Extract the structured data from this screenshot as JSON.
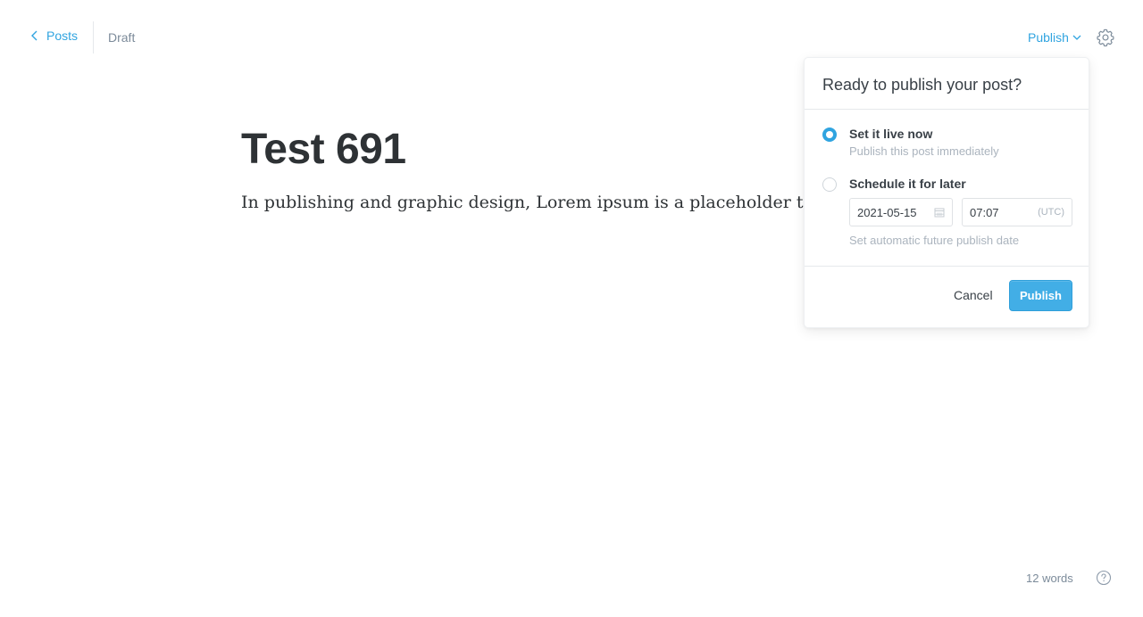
{
  "nav": {
    "back_label": "Posts",
    "status": "Draft",
    "publish_menu_label": "Publish"
  },
  "post": {
    "title": "Test 691",
    "body": "In publishing and graphic design, Lorem ipsum is a placeholder text 31"
  },
  "publish_popup": {
    "heading": "Ready to publish your post?",
    "options": [
      {
        "label": "Set it live now",
        "description": "Publish this post immediately",
        "selected": true
      },
      {
        "label": "Schedule it for later",
        "description": "Set automatic future publish date",
        "selected": false
      }
    ],
    "date_value": "2021-05-15",
    "time_value": "07:07",
    "timezone": "(UTC)",
    "cancel_label": "Cancel",
    "publish_label": "Publish"
  },
  "footer": {
    "word_count": "12 words"
  },
  "icons": {
    "back": "chevron-left-icon",
    "publish_menu": "chevron-down-icon",
    "settings": "gear-icon",
    "date": "calendar-icon",
    "help": "help-circle-icon"
  },
  "colors": {
    "accent": "#30a4e0",
    "publish_button": "#42aee6",
    "muted_text": "#abb4be"
  }
}
